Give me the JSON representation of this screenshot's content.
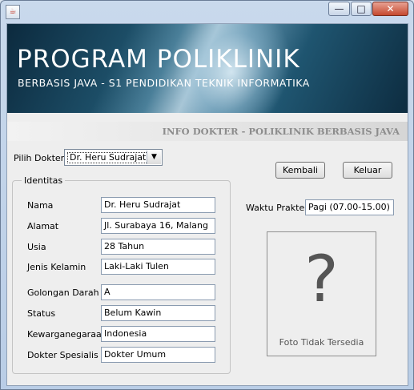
{
  "window": {
    "app_icon": "java-cup-icon",
    "controls": {
      "minimize": "—",
      "maximize": "□",
      "close": "✕"
    }
  },
  "banner": {
    "title": "PROGRAM POLIKLINIK",
    "subtitle": "BERBASIS JAVA - S1 PENDIDIKAN TEKNIK INFORMATIKA"
  },
  "info_title": "INFO DOKTER - POLIKLINIK BERBASIS JAVA",
  "doctor_select": {
    "label": "Pilih Dokter",
    "selected": "Dr. Heru Sudrajat",
    "arrow": "▼"
  },
  "buttons": {
    "kembali": "Kembali",
    "keluar": "Keluar"
  },
  "identitas": {
    "legend": "Identitas",
    "fields": [
      {
        "label": "Nama",
        "value": "Dr. Heru Sudrajat"
      },
      {
        "label": "Alamat",
        "value": "Jl. Surabaya 16, Malang"
      },
      {
        "label": "Usia",
        "value": "28 Tahun"
      },
      {
        "label": "Jenis Kelamin",
        "value": "Laki-Laki Tulen"
      },
      {
        "label": "Golongan Darah",
        "value": "A"
      },
      {
        "label": "Status",
        "value": "Belum Kawin"
      },
      {
        "label": "Kewarganegaraan",
        "value": "Indonesia"
      },
      {
        "label": "Dokter Spesialis",
        "value": "Dokter Umum"
      }
    ]
  },
  "practice": {
    "label": "Waktu Praktek",
    "value": "Pagi (07.00-15.00)"
  },
  "photo": {
    "placeholder": "?",
    "caption": "Foto Tidak Tersedia"
  }
}
